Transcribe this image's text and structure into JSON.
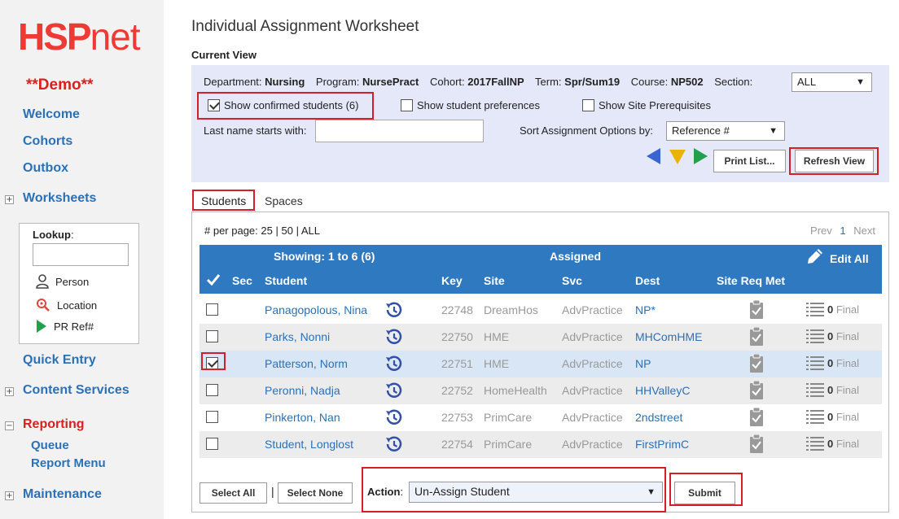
{
  "sidebar": {
    "logo": {
      "hsp": "HSP",
      "net": "net"
    },
    "demo": "**Demo**",
    "welcome": "Welcome",
    "cohorts": "Cohorts",
    "outbox": "Outbox",
    "worksheets": "Worksheets",
    "lookup": {
      "label": "Lookup",
      "person": "Person",
      "location": "Location",
      "prref": "PR Ref#"
    },
    "quick_entry": "Quick Entry",
    "content_services": "Content Services",
    "reporting": "Reporting",
    "queue": "Queue",
    "report_menu": "Report Menu",
    "maintenance": "Maintenance"
  },
  "page": {
    "title": "Individual Assignment Worksheet",
    "current_view": "Current View"
  },
  "filters": {
    "department_label": "Department:",
    "department": "Nursing",
    "program_label": "Program:",
    "program": "NursePract",
    "cohort_label": "Cohort:",
    "cohort": "2017FallNP",
    "term_label": "Term:",
    "term": "Spr/Sum19",
    "course_label": "Course:",
    "course": "NP502",
    "section_label": "Section:",
    "section": "ALL",
    "show_confirmed": "Show confirmed students (6)",
    "show_prefs": "Show student preferences",
    "show_prereqs": "Show Site Prerequisites",
    "lastname_label": "Last name starts with:",
    "lastname_value": "",
    "sort_label": "Sort Assignment Options by:",
    "sort_value": "Reference #",
    "print_list": "Print List...",
    "refresh_view": "Refresh View"
  },
  "tabs": {
    "students": "Students",
    "spaces": "Spaces"
  },
  "list": {
    "per_page_label": "# per page:",
    "pp25": "25",
    "pp50": "50",
    "ppall": "ALL",
    "prev": "Prev",
    "page": "1",
    "next": "Next",
    "showing": "Showing: 1 to 6 (6)",
    "assigned": "Assigned",
    "edit_all": "Edit All",
    "headers": {
      "sec": "Sec",
      "student": "Student",
      "key": "Key",
      "site": "Site",
      "svc": "Svc",
      "dest": "Dest",
      "sitereq": "Site Req Met"
    },
    "rows": [
      {
        "student": "Panagopolous, Nina",
        "key": "22748",
        "site": "DreamHos",
        "svc": "AdvPractice",
        "dest": "NP*",
        "count": "0",
        "status": "Final"
      },
      {
        "student": "Parks, Nonni",
        "key": "22750",
        "site": "HME",
        "svc": "AdvPractice",
        "dest": "MHComHME",
        "count": "0",
        "status": "Final"
      },
      {
        "student": "Patterson, Norm",
        "key": "22751",
        "site": "HME",
        "svc": "AdvPractice",
        "dest": "NP",
        "count": "0",
        "status": "Final"
      },
      {
        "student": "Peronni, Nadja",
        "key": "22752",
        "site": "HomeHealth",
        "svc": "AdvPractice",
        "dest": "HHValleyC",
        "count": "0",
        "status": "Final"
      },
      {
        "student": "Pinkerton, Nan",
        "key": "22753",
        "site": "PrimCare",
        "svc": "AdvPractice",
        "dest": "2ndstreet",
        "count": "0",
        "status": "Final"
      },
      {
        "student": "Student, Longlost",
        "key": "22754",
        "site": "PrimCare",
        "svc": "AdvPractice",
        "dest": "FirstPrimC",
        "count": "0",
        "status": "Final"
      }
    ]
  },
  "footer": {
    "select_all": "Select All",
    "separator": "|",
    "select_none": "Select None",
    "action_label": "Action",
    "action_value": "Un-Assign Student",
    "submit": "Submit"
  },
  "colors": {
    "accent": "#2f79c1",
    "highlight": "#d51f26",
    "brand": "#ee3a35"
  }
}
